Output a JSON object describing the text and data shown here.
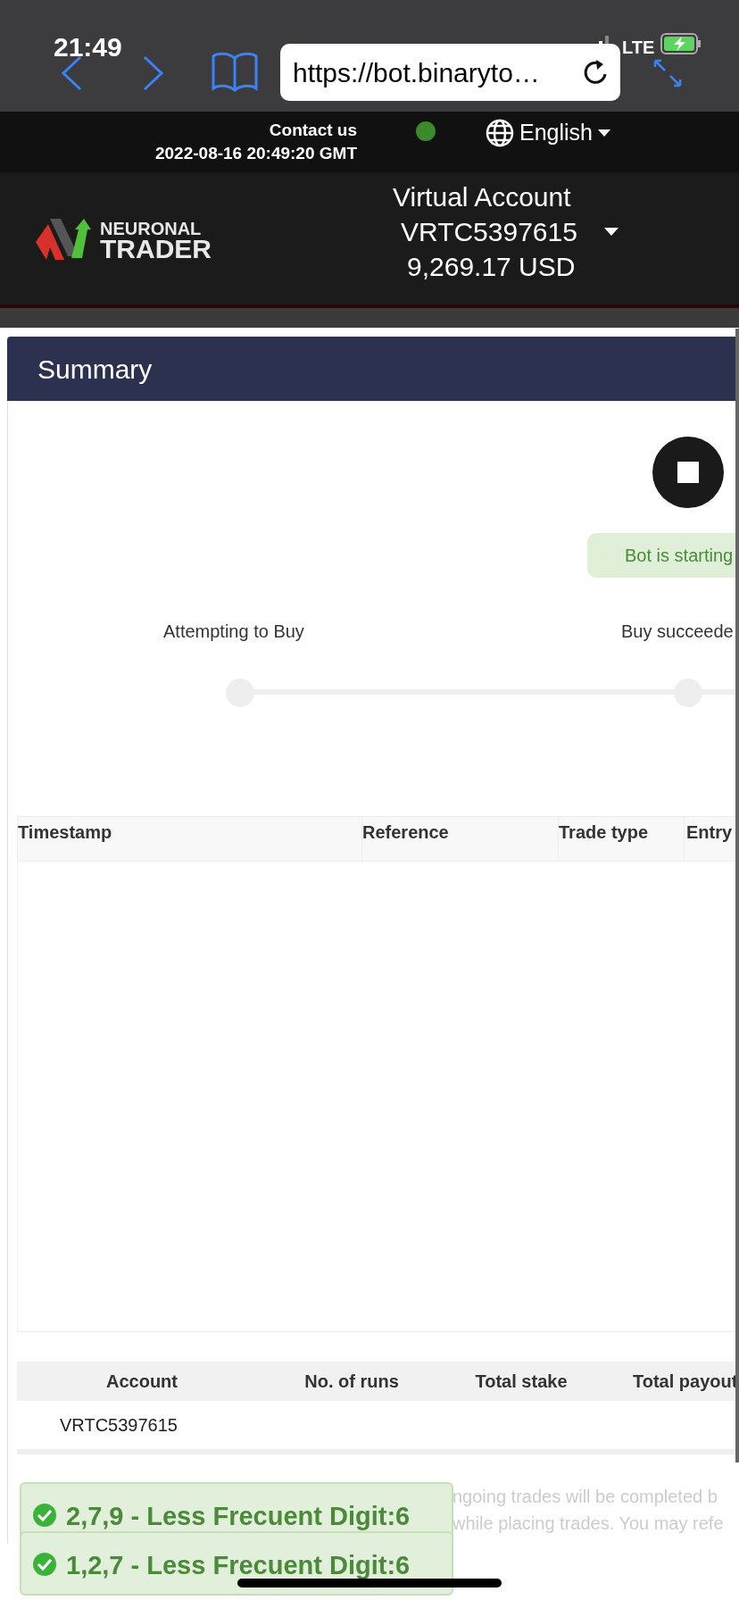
{
  "status_bar": {
    "time": "21:49",
    "network": "LTE"
  },
  "browser": {
    "url": "https://bot.binaryto…"
  },
  "top_bar": {
    "contact": "Contact us",
    "datetime": "2022-08-16 20:49:20 GMT",
    "connected": true,
    "language": "English"
  },
  "logo": {
    "line_1": "NEURONAL",
    "line_2": "TRADER"
  },
  "account": {
    "type": "Virtual Account",
    "id": "VRTC5397615",
    "balance": "9,269.17 USD"
  },
  "summary": {
    "title": "Summary",
    "bot_status": "Bot is starting",
    "steps": [
      {
        "label": "Attempting to Buy"
      },
      {
        "label": "Buy succeede"
      }
    ]
  },
  "trades_table": {
    "columns": [
      "Timestamp",
      "Reference",
      "Trade type",
      "Entry"
    ]
  },
  "totals_table": {
    "columns": [
      "Account",
      "No. of runs",
      "Total stake",
      "Total payout"
    ],
    "rows": [
      [
        "VRTC5397615"
      ]
    ]
  },
  "disclaimer_fragments": [
    "ngoing trades will be completed b",
    "while placing trades. You may refe"
  ],
  "notifications": [
    {
      "text": "2,7,9 - Less Frecuent Digit:6"
    },
    {
      "text": "1,2,7 - Less Frecuent Digit:6"
    }
  ]
}
